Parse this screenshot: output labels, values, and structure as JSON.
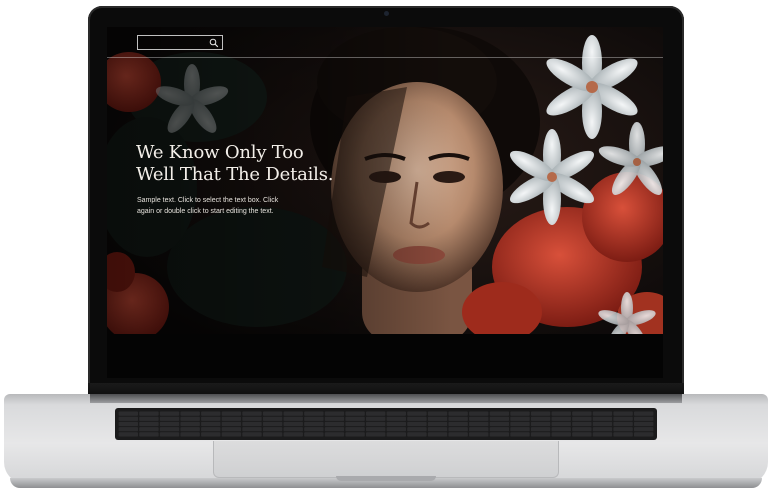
{
  "search": {
    "placeholder": "",
    "icon": "search-icon"
  },
  "hero": {
    "title_line1": "We Know Only Too",
    "title_line2": "Well That The Details.",
    "body": "Sample text. Click to select the text box. Click again or double click to start editing the text."
  },
  "colors": {
    "bezel": "#0b0b0b",
    "screen_bg": "#0c0909",
    "flower_red": "#b32a1c",
    "flower_white": "#e8ecef",
    "heading_text": "#f3efe9",
    "laptop_silver": "#dcdcdd"
  }
}
